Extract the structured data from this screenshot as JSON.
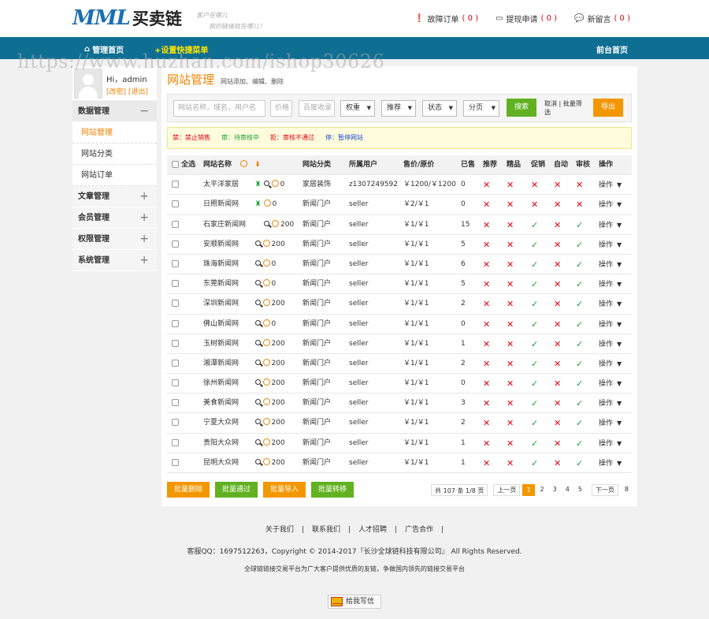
{
  "header": {
    "logo_mark": "MML",
    "logo_text": "买卖链",
    "slogan_line1": "客户在哪儿",
    "slogan_line2": "我的链接就在哪儿！",
    "links": [
      {
        "icon": "info-icon",
        "label": "故障订单",
        "count": "( 0 )"
      },
      {
        "icon": "card-icon",
        "label": "提现申请",
        "count": "( 0 )"
      },
      {
        "icon": "chat-icon",
        "label": "新留言",
        "count": "( 0 )"
      }
    ]
  },
  "nav": {
    "home": "管理首页",
    "quick": "+设置快捷菜单",
    "front": "前台首页"
  },
  "watermark": "https://www.huzhan.com/ishop30626",
  "user": {
    "greeting": "Hi，admin",
    "modify": "[改密]",
    "logout": "[退出]"
  },
  "sidebar": {
    "group_data": "数据管理",
    "group_data_toggle": "−",
    "sub": [
      "网站管理",
      "网站分类",
      "网站订单"
    ],
    "groups": [
      {
        "label": "文章管理",
        "toggle": "+"
      },
      {
        "label": "会员管理",
        "toggle": "+"
      },
      {
        "label": "权限管理",
        "toggle": "+"
      },
      {
        "label": "系统管理",
        "toggle": "+"
      }
    ]
  },
  "page": {
    "title": "网站管理",
    "subtitle": "网站添加、编辑、删除"
  },
  "filter": {
    "keyword_placeholder": "网站名称，域名，用户名",
    "price_placeholder": "价格",
    "baidu_placeholder": "百度收录",
    "selects": [
      "权重",
      "推荐",
      "状态",
      "分页"
    ],
    "search": "搜索",
    "cancel": "取消 | 批量筛选",
    "export": "导出"
  },
  "legend": [
    {
      "label": "禁：禁止销售"
    },
    {
      "label": "审：待审核中"
    },
    {
      "label": "拒：审核不通过"
    },
    {
      "label": "停：暂停网站"
    }
  ],
  "table": {
    "headers": {
      "select_all": "全选",
      "name": "网站名称",
      "category": "网站分类",
      "user": "所属用户",
      "price": "售价/原价",
      "sold": "已售",
      "recommend": "推荐",
      "featured": "精品",
      "promo": "促销",
      "auto": "自动",
      "audit": "审核",
      "ops": "操作"
    },
    "op_label": "操作",
    "rows": [
      {
        "name": "太平洋家居",
        "gr": true,
        "mag": true,
        "num": "0",
        "cat": "家居装饰",
        "user": "z1307249592",
        "price": "￥1200/￥1200",
        "sold": "0",
        "m": [
          "x",
          "x",
          "x",
          "x",
          "x"
        ]
      },
      {
        "name": "日照新闻网",
        "gr": true,
        "mag": false,
        "num": "0",
        "cat": "新闻门户",
        "user": "seller",
        "price": "￥2/￥1",
        "sold": "0",
        "m": [
          "x",
          "x",
          "x",
          "x",
          "x"
        ]
      },
      {
        "name": "石家庄新闻网",
        "gr": false,
        "mag": true,
        "num": "200",
        "cat": "新闻门户",
        "user": "seller",
        "price": "￥1/￥1",
        "sold": "15",
        "m": [
          "x",
          "x",
          "v",
          "x",
          "v"
        ]
      },
      {
        "name": "安顺新闻网",
        "gr": false,
        "mag": true,
        "num": "200",
        "cat": "新闻门户",
        "user": "seller",
        "price": "￥1/￥1",
        "sold": "5",
        "m": [
          "x",
          "x",
          "v",
          "x",
          "v"
        ]
      },
      {
        "name": "珠海新闻网",
        "gr": false,
        "mag": true,
        "num": "0",
        "cat": "新闻门户",
        "user": "seller",
        "price": "￥1/￥1",
        "sold": "6",
        "m": [
          "x",
          "x",
          "v",
          "x",
          "v"
        ]
      },
      {
        "name": "东莞新闻网",
        "gr": false,
        "mag": true,
        "num": "0",
        "cat": "新闻门户",
        "user": "seller",
        "price": "￥1/￥1",
        "sold": "5",
        "m": [
          "x",
          "x",
          "v",
          "x",
          "v"
        ]
      },
      {
        "name": "深圳新闻网",
        "gr": false,
        "mag": true,
        "num": "200",
        "cat": "新闻门户",
        "user": "seller",
        "price": "￥1/￥1",
        "sold": "2",
        "m": [
          "x",
          "x",
          "v",
          "x",
          "v"
        ]
      },
      {
        "name": "佛山新闻网",
        "gr": false,
        "mag": true,
        "num": "0",
        "cat": "新闻门户",
        "user": "seller",
        "price": "￥1/￥1",
        "sold": "0",
        "m": [
          "x",
          "x",
          "v",
          "x",
          "v"
        ]
      },
      {
        "name": "玉树新闻网",
        "gr": false,
        "mag": true,
        "num": "200",
        "cat": "新闻门户",
        "user": "seller",
        "price": "￥1/￥1",
        "sold": "1",
        "m": [
          "x",
          "x",
          "v",
          "x",
          "v"
        ]
      },
      {
        "name": "湘潭新闻网",
        "gr": false,
        "mag": true,
        "num": "200",
        "cat": "新闻门户",
        "user": "seller",
        "price": "￥1/￥1",
        "sold": "2",
        "m": [
          "x",
          "x",
          "v",
          "x",
          "v"
        ]
      },
      {
        "name": "徐州新闻网",
        "gr": false,
        "mag": true,
        "num": "200",
        "cat": "新闻门户",
        "user": "seller",
        "price": "￥1/￥1",
        "sold": "0",
        "m": [
          "x",
          "x",
          "v",
          "x",
          "v"
        ]
      },
      {
        "name": "美食新闻网",
        "gr": false,
        "mag": true,
        "num": "200",
        "cat": "新闻门户",
        "user": "seller",
        "price": "￥1/￥1",
        "sold": "3",
        "m": [
          "x",
          "x",
          "v",
          "x",
          "v"
        ]
      },
      {
        "name": "宁夏大众网",
        "gr": false,
        "mag": true,
        "num": "200",
        "cat": "新闻门户",
        "user": "seller",
        "price": "￥1/￥1",
        "sold": "2",
        "m": [
          "x",
          "x",
          "v",
          "x",
          "v"
        ]
      },
      {
        "name": "贵阳大众网",
        "gr": false,
        "mag": true,
        "num": "200",
        "cat": "新闻门户",
        "user": "seller",
        "price": "￥1/￥1",
        "sold": "1",
        "m": [
          "x",
          "x",
          "v",
          "x",
          "v"
        ]
      },
      {
        "name": "昆明大众网",
        "gr": false,
        "mag": true,
        "num": "200",
        "cat": "新闻门户",
        "user": "seller",
        "price": "￥1/￥1",
        "sold": "1",
        "m": [
          "x",
          "x",
          "v",
          "x",
          "v"
        ]
      }
    ]
  },
  "bulk": [
    "批量删除",
    "批量通过",
    "批量导入",
    "批量转移"
  ],
  "pager": {
    "info": "共 107 条 1/8 页",
    "prev": "上一页",
    "pages": [
      "1",
      "2",
      "3",
      "4",
      "5"
    ],
    "next": "下一页",
    "last": "8"
  },
  "footer": {
    "links": [
      "关于我们",
      "|",
      "联系我们",
      "|",
      "人才招聘",
      "|",
      "广告合作",
      "|"
    ],
    "copyright": "客服QQ：1697512263，Copyright © 2014-2017『长沙全球链科技有限公司』 All Rights Reserved.",
    "slogan": "全球链链接交易平台为广大客户提供优质的友链，争做国内领先的链接交易平台",
    "write": "给我写信"
  },
  "colors": {
    "nav_bg": "#0f6f92",
    "accent": "#f08300",
    "green": "#61b121",
    "red": "#e60012"
  }
}
